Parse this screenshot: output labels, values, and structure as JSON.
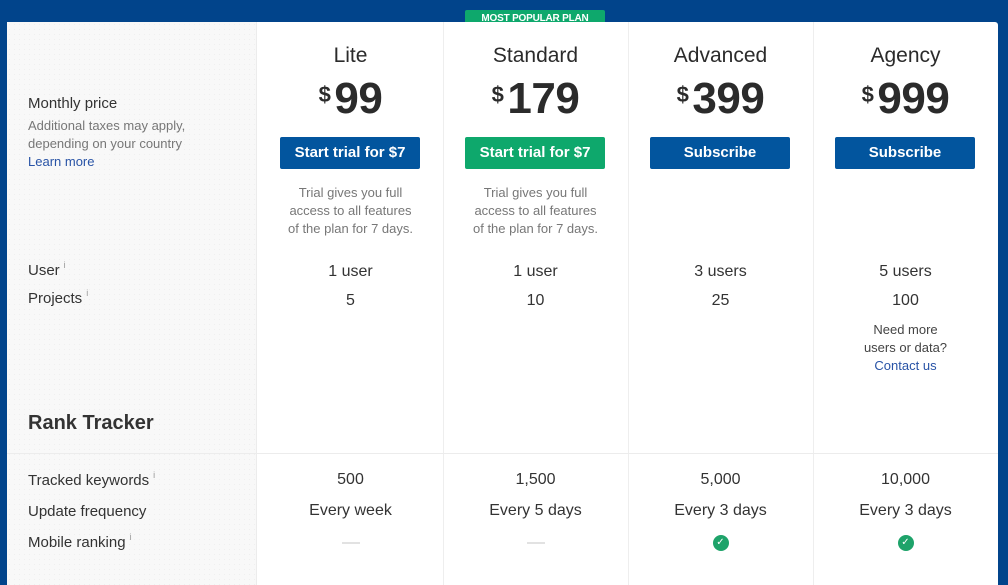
{
  "badge": "MOST POPULAR PLAN",
  "labels": {
    "monthly_price": "Monthly price",
    "taxes_line1": "Additional taxes may apply,",
    "taxes_line2": "depending on your country",
    "learn_more": "Learn more",
    "user": "User",
    "projects": "Projects",
    "section_rank_tracker": "Rank Tracker",
    "tracked_keywords": "Tracked keywords",
    "update_frequency": "Update frequency",
    "mobile_ranking": "Mobile ranking",
    "info_glyph": "i"
  },
  "plans": [
    {
      "name": "Lite",
      "currency": "$",
      "price": "99",
      "button": "Start trial for $7",
      "button_style": "blue",
      "note": [
        "Trial gives you full",
        "access to all features",
        "of the plan for 7 days."
      ],
      "users": "1 user",
      "projects": "5",
      "tracked_keywords": "500",
      "update_frequency": "Every week",
      "mobile_ranking": false
    },
    {
      "name": "Standard",
      "currency": "$",
      "price": "179",
      "button": "Start trial for $7",
      "button_style": "green",
      "note": [
        "Trial gives you full",
        "access to all features",
        "of the plan for 7 days."
      ],
      "users": "1 user",
      "projects": "10",
      "tracked_keywords": "1,500",
      "update_frequency": "Every 5 days",
      "mobile_ranking": false
    },
    {
      "name": "Advanced",
      "currency": "$",
      "price": "399",
      "button": "Subscribe",
      "button_style": "blue",
      "users": "3 users",
      "projects": "25",
      "tracked_keywords": "5,000",
      "update_frequency": "Every 3 days",
      "mobile_ranking": true
    },
    {
      "name": "Agency",
      "currency": "$",
      "price": "999",
      "button": "Subscribe",
      "button_style": "blue",
      "users": "5 users",
      "projects": "100",
      "extra": [
        "Need more",
        "users or data?"
      ],
      "contact_link": "Contact us",
      "tracked_keywords": "10,000",
      "update_frequency": "Every 3 days",
      "mobile_ranking": true
    }
  ],
  "icons": {
    "check": "✓"
  },
  "colors": {
    "frame": "#01448b",
    "primary_button": "#02559e",
    "popular_button": "#0ea86c",
    "check": "#1ea36a",
    "link": "#2853a6"
  }
}
